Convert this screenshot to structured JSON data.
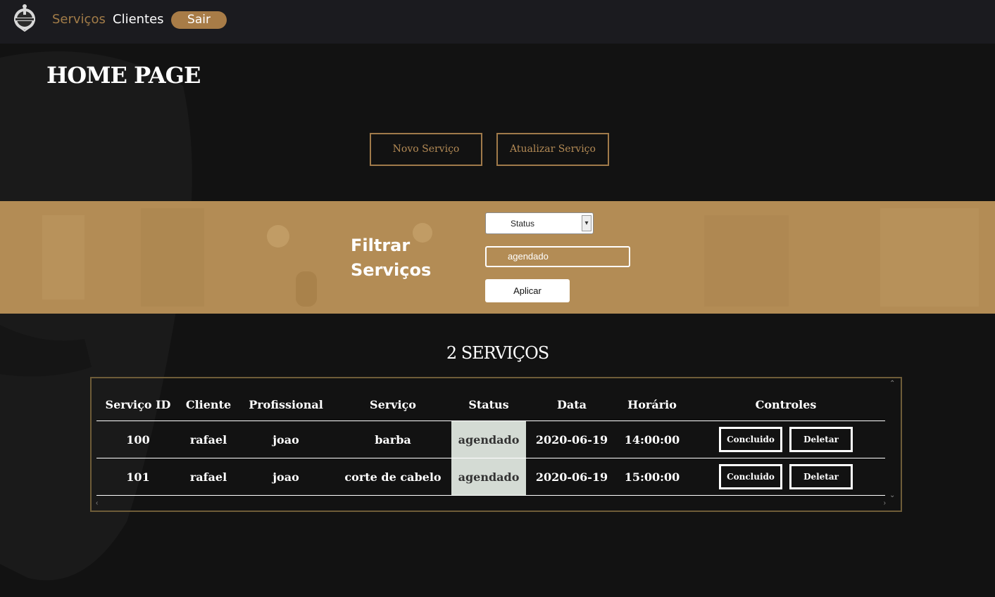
{
  "nav": {
    "links": [
      {
        "label": "Serviços"
      },
      {
        "label": "Clientes"
      }
    ],
    "logout_label": "Sair"
  },
  "page": {
    "title": "HOME PAGE",
    "new_service_label": "Novo Serviço",
    "update_service_label": "Atualizar Serviço"
  },
  "filter": {
    "title_line1": "Filtrar",
    "title_line2": "Serviços",
    "select_value": "Status",
    "input_value": "agendado",
    "apply_label": "Aplicar"
  },
  "results": {
    "count_label": "2 SERVIÇOS",
    "columns": [
      "Serviço ID",
      "Cliente",
      "Profissional",
      "Serviço",
      "Status",
      "Data",
      "Horário",
      "Controles"
    ],
    "rows": [
      {
        "id": "100",
        "cliente": "rafael",
        "profissional": "joao",
        "servico": "barba",
        "status": "agendado",
        "data": "2020-06-19",
        "horario": "14:00:00",
        "concluido_label": "Concluido",
        "deletar_label": "Deletar"
      },
      {
        "id": "101",
        "cliente": "rafael",
        "profissional": "joao",
        "servico": "corte de cabelo",
        "status": "agendado",
        "data": "2020-06-19",
        "horario": "15:00:00",
        "concluido_label": "Concluido",
        "deletar_label": "Deletar"
      }
    ]
  },
  "icons": {
    "logo": "barbershop-logo-icon",
    "select_arrow": "chevron-down-icon"
  },
  "colors": {
    "accent": "#a87c47",
    "filter_band": "#b38c55",
    "background": "#121212",
    "status_cell": "#d4dbd4"
  }
}
